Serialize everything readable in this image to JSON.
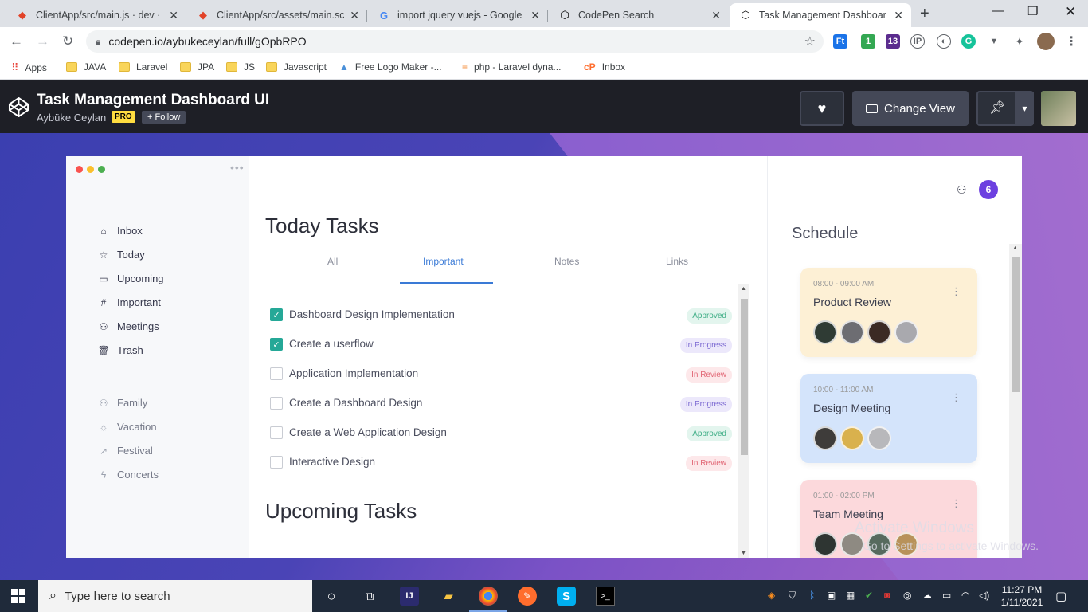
{
  "browser": {
    "tabs": [
      {
        "title": "ClientApp/src/main.js · dev · M",
        "icon": "gitlab-icon"
      },
      {
        "title": "ClientApp/src/assets/main.scss",
        "icon": "gitlab-icon"
      },
      {
        "title": "import jquery vuejs - Google S",
        "icon": "google-icon"
      },
      {
        "title": "CodePen Search",
        "icon": "codepen-icon"
      },
      {
        "title": "Task Management Dashboard",
        "icon": "codepen-icon"
      }
    ],
    "url": "codepen.io/aybukeceylan/full/gOpbRPO",
    "extensions": [
      "Ft",
      "1",
      "13",
      "IP",
      "G"
    ],
    "bookmarks": [
      "Apps",
      "JAVA",
      "Laravel",
      "JPA",
      "JS",
      "Javascript",
      "Free Logo Maker -...",
      "php - Laravel dyna...",
      "Inbox"
    ]
  },
  "codepen": {
    "title": "Task Management Dashboard UI",
    "author": "Aybüke Ceylan",
    "pro_badge": "PRO",
    "follow_label": "+ Follow",
    "change_view_label": "Change View"
  },
  "sidebar": {
    "primary": [
      {
        "label": "Inbox",
        "icon": "inbox-icon"
      },
      {
        "label": "Today",
        "icon": "star-icon"
      },
      {
        "label": "Upcoming",
        "icon": "calendar-icon"
      },
      {
        "label": "Important",
        "icon": "hash-icon"
      },
      {
        "label": "Meetings",
        "icon": "users-icon"
      },
      {
        "label": "Trash",
        "icon": "trash-icon"
      }
    ],
    "secondary": [
      {
        "label": "Family",
        "icon": "users-icon"
      },
      {
        "label": "Vacation",
        "icon": "sun-icon"
      },
      {
        "label": "Festival",
        "icon": "trending-icon"
      },
      {
        "label": "Concerts",
        "icon": "zap-icon"
      }
    ]
  },
  "main": {
    "today_title": "Today Tasks",
    "tabs": [
      "All",
      "Important",
      "Notes",
      "Links"
    ],
    "active_tab": "Important",
    "tasks": [
      {
        "name": "Dashboard Design Implementation",
        "checked": true,
        "status": "Approved"
      },
      {
        "name": "Create a userflow",
        "checked": true,
        "status": "In Progress"
      },
      {
        "name": "Application Implementation",
        "checked": false,
        "status": "In Review"
      },
      {
        "name": "Create a Dashboard Design",
        "checked": false,
        "status": "In Progress"
      },
      {
        "name": "Create a Web Application Design",
        "checked": false,
        "status": "Approved"
      },
      {
        "name": "Interactive Design",
        "checked": false,
        "status": "In Review"
      }
    ],
    "upcoming_title": "Upcoming Tasks"
  },
  "right": {
    "notification_count": "6",
    "schedule_title": "Schedule",
    "events": [
      {
        "time": "08:00 - 09:00 AM",
        "title": "Product Review",
        "color": "#fdf0d5",
        "avatars": 4
      },
      {
        "time": "10:00 - 11:00 AM",
        "title": "Design Meeting",
        "color": "#d4e4fb",
        "avatars": 3
      },
      {
        "time": "01:00 - 02:00 PM",
        "title": "Team Meeting",
        "color": "#fcd9dc",
        "avatars": 4
      }
    ]
  },
  "watermark": {
    "line1": "Activate Windows",
    "line2": "Go to Settings to activate Windows."
  },
  "taskbar": {
    "search_placeholder": "Type here to search",
    "time": "11:27 PM",
    "date": "1/11/2021"
  },
  "colors": {
    "accent": "#3a7ad6",
    "checked": "#25a897",
    "notification": "#6c40e0",
    "codepen_bar": "#1e1f26"
  }
}
